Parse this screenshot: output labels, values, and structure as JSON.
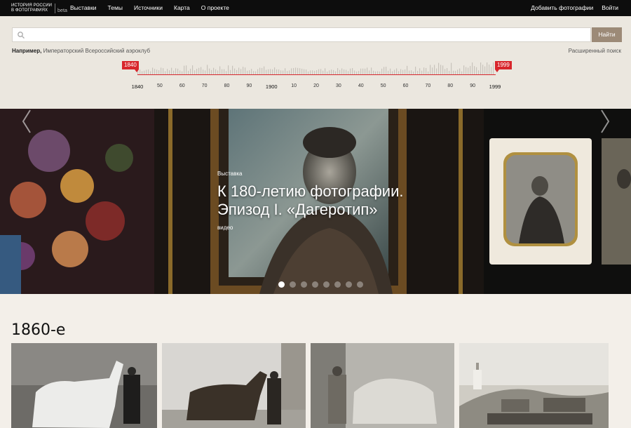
{
  "header": {
    "logo_line1": "ИСТОРИЯ РОССИИ",
    "logo_line2": "В ФОТОГРАФИЯХ",
    "logo_beta": "beta",
    "nav": [
      "Выставки",
      "Темы",
      "Источники",
      "Карта",
      "О проекте"
    ],
    "add_photo": "Добавить фотографии",
    "login": "Войти"
  },
  "search": {
    "placeholder": "",
    "button": "Найти",
    "example_label": "Например,",
    "example_text": "Императорский Всероссийский аэроклуб",
    "advanced": "Расширенный поиск"
  },
  "timeline": {
    "start_flag": "1840",
    "end_flag": "1999",
    "ticks": [
      "1840",
      "50",
      "60",
      "70",
      "80",
      "90",
      "1900",
      "10",
      "20",
      "30",
      "40",
      "50",
      "60",
      "70",
      "80",
      "90",
      "1999"
    ]
  },
  "hero": {
    "kind": "Выставка",
    "title": "К 180-летию фотографии. Эпизод I. «Дагеротип»",
    "sub": "видео",
    "slide_count": 8,
    "active_slide": 1
  },
  "section": {
    "title": "1860-е"
  },
  "icons": {
    "search": "magnifier-icon",
    "prev": "chevron-left-icon",
    "next": "chevron-right-icon"
  },
  "colors": {
    "accent_red": "#d8262c",
    "button_brown": "#9c8a77",
    "topbar": "#0d0d0d",
    "page_bg": "#f3efe9"
  }
}
